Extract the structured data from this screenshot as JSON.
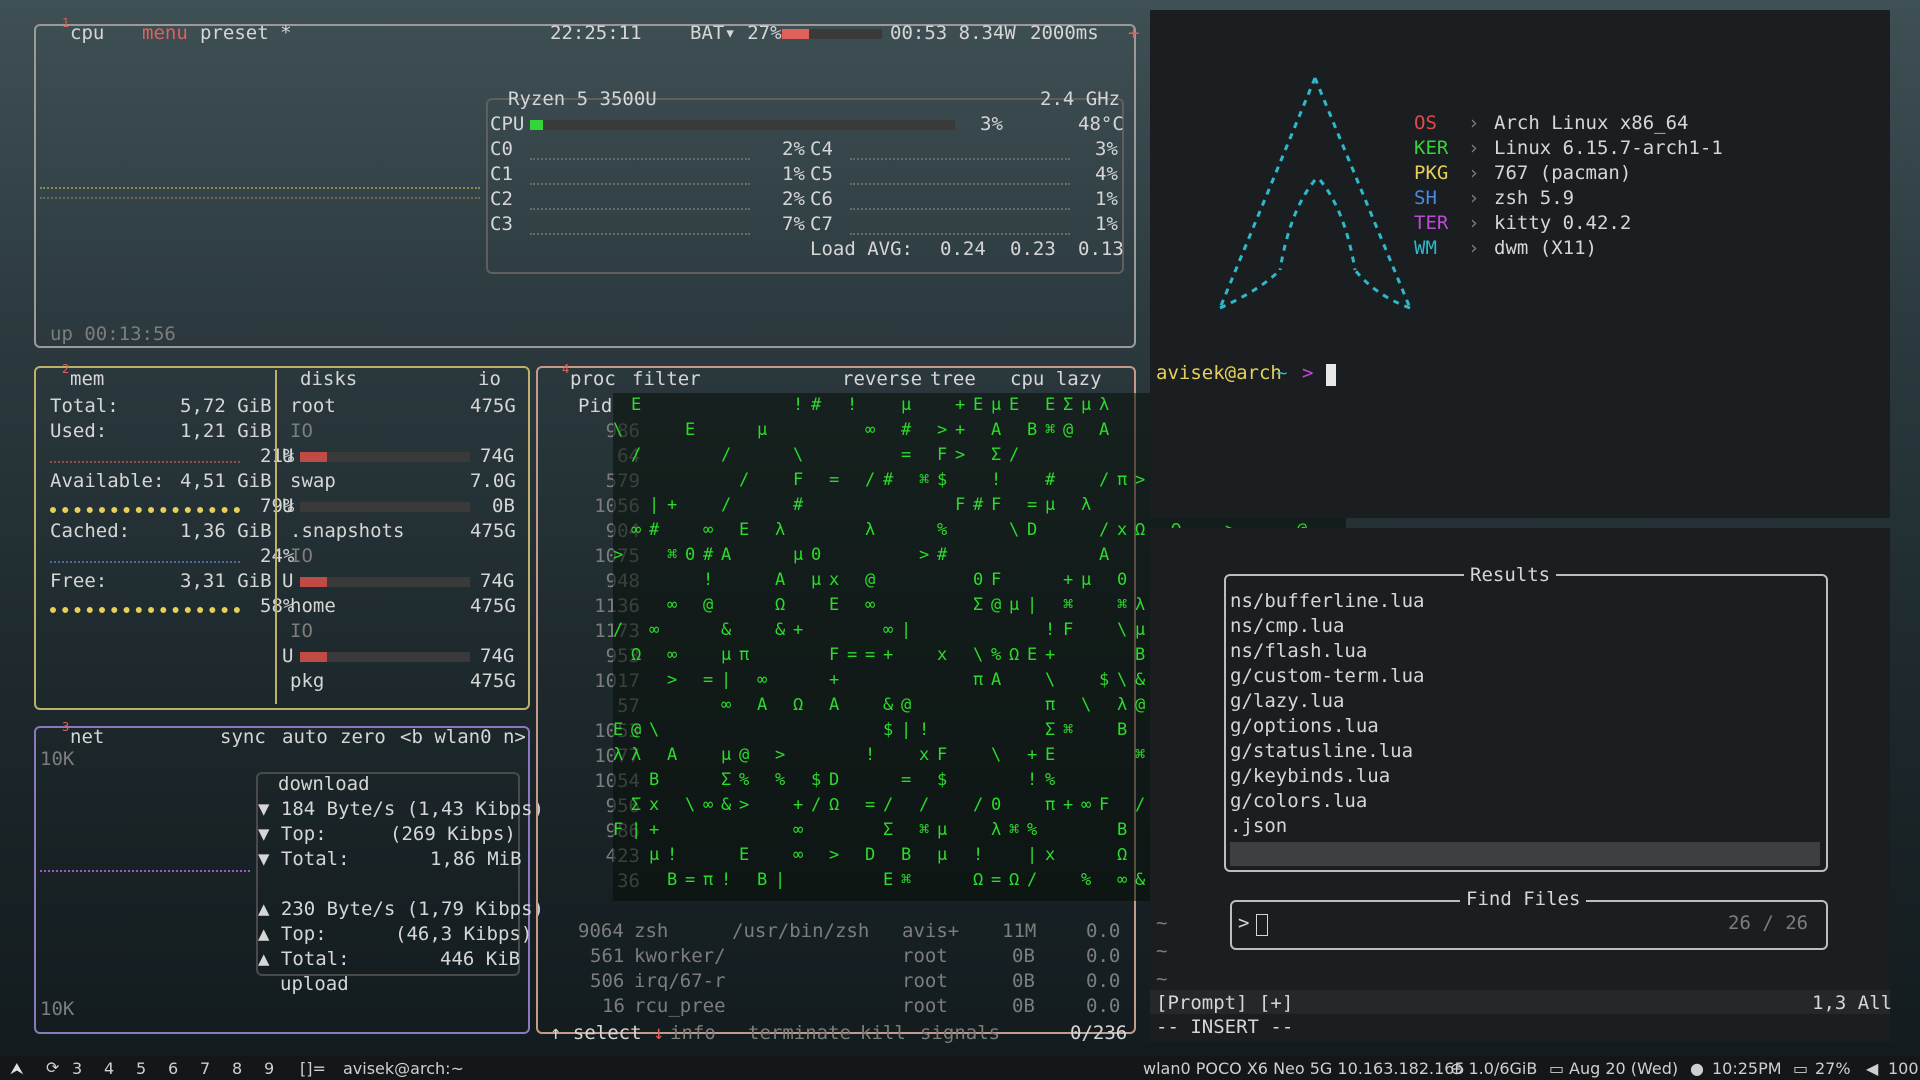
{
  "btop": {
    "cpu_tab": "cpu",
    "cpu_tab_num": "1",
    "menu": "menu",
    "preset": "preset *",
    "clock": "22:25:11",
    "battery_label": "BAT▾ 27%",
    "battery_pct": 27,
    "battery_time": "00:53 8.34W",
    "interval": "2000ms",
    "uptime": "up 00:13:56",
    "cpu_model": "Ryzen 5 3500U",
    "freq": "2.4 GHz",
    "cpu_total": {
      "label": "CPU",
      "pct": "3%",
      "temp": "48°C",
      "value": 3
    },
    "cores_left": [
      {
        "name": "C0",
        "pct": "2%"
      },
      {
        "name": "C1",
        "pct": "1%"
      },
      {
        "name": "C2",
        "pct": "2%"
      },
      {
        "name": "C3",
        "pct": "7%"
      }
    ],
    "cores_right": [
      {
        "name": "C4",
        "pct": "3%"
      },
      {
        "name": "C5",
        "pct": "4%"
      },
      {
        "name": "C6",
        "pct": "1%"
      },
      {
        "name": "C7",
        "pct": "1%"
      }
    ],
    "load_label": "Load AVG:",
    "load": [
      "0.24",
      "0.23",
      "0.13"
    ],
    "mem": {
      "tab_num": "2",
      "title": "mem",
      "total_label": "Total:",
      "total": "5,72 GiB",
      "used_label": "Used:",
      "used": "1,21 GiB",
      "used_pct": "21%",
      "avail_label": "Available:",
      "avail": "4,51 GiB",
      "avail_pct": "79%",
      "cached_label": "Cached:",
      "cached": "1,36 GiB",
      "cached_pct": "24%",
      "free_label": "Free:",
      "free": "3,31 GiB",
      "free_pct": "58%"
    },
    "disks": {
      "title": "disks",
      "io_label": "io",
      "root": "root",
      "root_size": "475G",
      "io_label_small": "IO",
      "root_used": "74G",
      "swap": "swap",
      "swap_size": "7.0G",
      "swap_used": "0B",
      "snapshots": ".snapshots",
      "snapshots_size": "475G",
      "snapshots_used": "74G",
      "home": "home",
      "home_size": "475G",
      "home_used": "74G",
      "pkg": "pkg",
      "pkg_size": "475G",
      "u_label": "U"
    },
    "net": {
      "tab_num": "3",
      "title": "net",
      "sync": "sync",
      "auto": "auto",
      "zero": "zero",
      "iface": "<b wlan0 n>",
      "scale_top": "10K",
      "scale_bottom": "10K",
      "download": "download",
      "down_rate": "184 Byte/s (1,43 Kibps)",
      "down_top": "(269 Kibps)",
      "down_top_label": "Top:",
      "down_total": "1,86 MiB",
      "down_total_label": "Total:",
      "up_rate": "230 Byte/s (1,79 Kibps)",
      "up_top": "(46,3 Kibps)",
      "up_top_label": "Top:",
      "up_total": "446 KiB",
      "up_total_label": "Total:",
      "upload": "upload"
    },
    "proc": {
      "tab_num": "4",
      "title": "proc",
      "filter": "filter",
      "reverse": "reverse",
      "tree": "tree",
      "sort": "cpu lazy",
      "pid_header": "Pid",
      "pids": [
        "986",
        "64",
        "579",
        "1056",
        "904",
        "1075",
        "948",
        "1136",
        "1173",
        "953",
        "1017",
        "57",
        "1053",
        "1077",
        "1054",
        "956",
        "986",
        "423",
        "36"
      ],
      "rows": [
        {
          "pid": "9064",
          "name": "zsh",
          "cmd": "/usr/bin/zsh",
          "user": "avis+",
          "mem": "11M",
          "cpu": "0.0"
        },
        {
          "pid": "561",
          "name": "kworker/",
          "cmd": "",
          "user": "root",
          "mem": "0B",
          "cpu": "0.0"
        },
        {
          "pid": "506",
          "name": "irq/67-r",
          "cmd": "",
          "user": "root",
          "mem": "0B",
          "cpu": "0.0"
        },
        {
          "pid": "16",
          "name": "rcu_pree",
          "cmd": "",
          "user": "root",
          "mem": "0B",
          "cpu": "0.0"
        }
      ],
      "select": "select",
      "info": "info",
      "terminate": "terminate",
      "kill": "kill",
      "signals": "signals",
      "count": "0/236"
    }
  },
  "fetch": {
    "os_label": "OS",
    "os": "Arch Linux x86_64",
    "ker_label": "KER",
    "ker": "Linux 6.15.7-arch1-1",
    "pkg_label": "PKG",
    "pkg": "767 (pacman)",
    "sh_label": "SH",
    "sh": "zsh 5.9",
    "ter_label": "TER",
    "ter": "kitty 0.42.2",
    "wm_label": "WM",
    "wm": "dwm (X11)",
    "arrow": "›",
    "prompt_user": "avisek@arch",
    "prompt_dir": "~",
    "prompt_sym": ">"
  },
  "nvim": {
    "results_title": "Results",
    "results": [
      "ns/bufferline.lua",
      "ns/cmp.lua",
      "ns/flash.lua",
      "g/custom-term.lua",
      "g/lazy.lua",
      "g/options.lua",
      "g/statusline.lua",
      "g/keybinds.lua",
      "g/colors.lua",
      ".json"
    ],
    "find_title": "Find Files",
    "prompt": ">",
    "count": "26 / 26",
    "status_left": "[Prompt] [+]",
    "status_right": "1,3 All",
    "mode": "-- INSERT --",
    "tilde": "~"
  },
  "bar": {
    "tags": [
      "3",
      "4",
      "5",
      "6",
      "7",
      "8",
      "9"
    ],
    "layout": "[]=",
    "title": "avisek@arch:~",
    "wifi": "wlan0 POCO X6 Neo 5G 10.163.182.165",
    "mem": "⊕ 1.0/6GiB",
    "date": "Aug 20 (Wed)",
    "time": "10:25PM",
    "battery": "27%",
    "volume": "100"
  }
}
